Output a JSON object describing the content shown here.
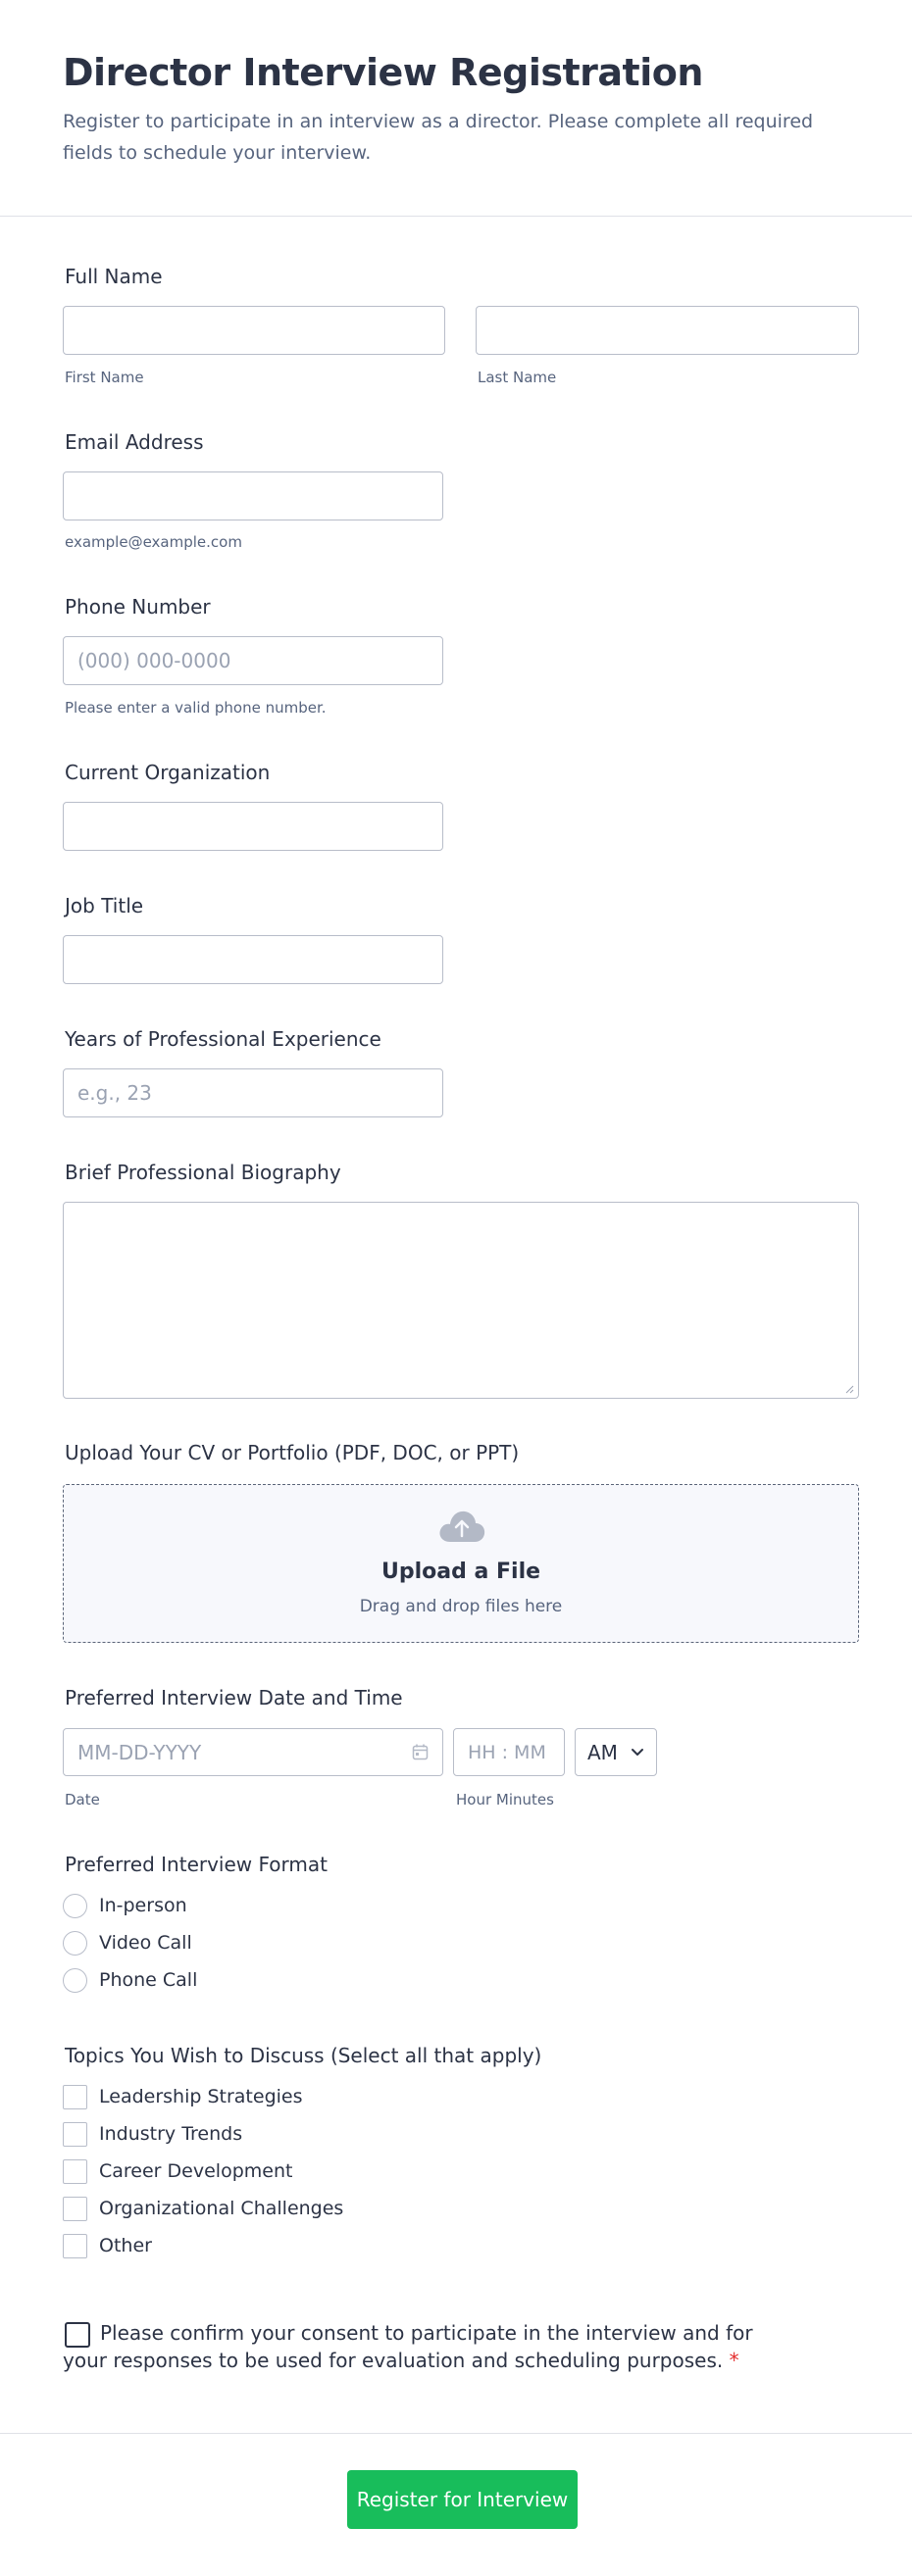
{
  "header": {
    "title": "Director Interview Registration",
    "subtitle": "Register to participate in an interview as a director. Please complete all required fields to schedule your interview."
  },
  "full_name": {
    "label": "Full Name",
    "first_value": "",
    "first_sublabel": "First Name",
    "last_value": "",
    "last_sublabel": "Last Name"
  },
  "email": {
    "label": "Email Address",
    "value": "",
    "sublabel": "example@example.com"
  },
  "phone": {
    "label": "Phone Number",
    "placeholder": "(000) 000-0000",
    "sublabel": "Please enter a valid phone number."
  },
  "organization": {
    "label": "Current Organization",
    "value": ""
  },
  "job_title": {
    "label": "Job Title",
    "value": ""
  },
  "experience": {
    "label": "Years of Professional Experience",
    "placeholder": "e.g., 23"
  },
  "biography": {
    "label": "Brief Professional Biography",
    "value": ""
  },
  "upload": {
    "label": "Upload Your CV or Portfolio (PDF, DOC, or PPT)",
    "title": "Upload a File",
    "hint": "Drag and drop files here",
    "icon": "cloud-upload-icon"
  },
  "datetime": {
    "label": "Preferred Interview Date and Time",
    "date_placeholder": "MM-DD-YYYY",
    "date_sublabel": "Date",
    "time_placeholder": "HH : MM",
    "time_sublabel": "Hour Minutes",
    "ampm_value": "AM",
    "icon": "calendar-icon"
  },
  "format": {
    "label": "Preferred Interview Format",
    "options": [
      "In-person",
      "Video Call",
      "Phone Call"
    ]
  },
  "topics": {
    "label": "Topics You Wish to Discuss (Select all that apply)",
    "options": [
      "Leadership Strategies",
      "Industry Trends",
      "Career Development",
      "Organizational Challenges",
      "Other"
    ]
  },
  "consent": {
    "text": "Please confirm your consent to participate in the interview and for your responses to be used for evaluation and scheduling purposes.",
    "required_mark": "*"
  },
  "submit": {
    "label": "Register for Interview"
  },
  "colors": {
    "primary_text": "#2c3345",
    "secondary_text": "#57647e",
    "submit_green": "#18bd5b",
    "required_red": "#e42d2d",
    "border": "#b8bdc9"
  }
}
